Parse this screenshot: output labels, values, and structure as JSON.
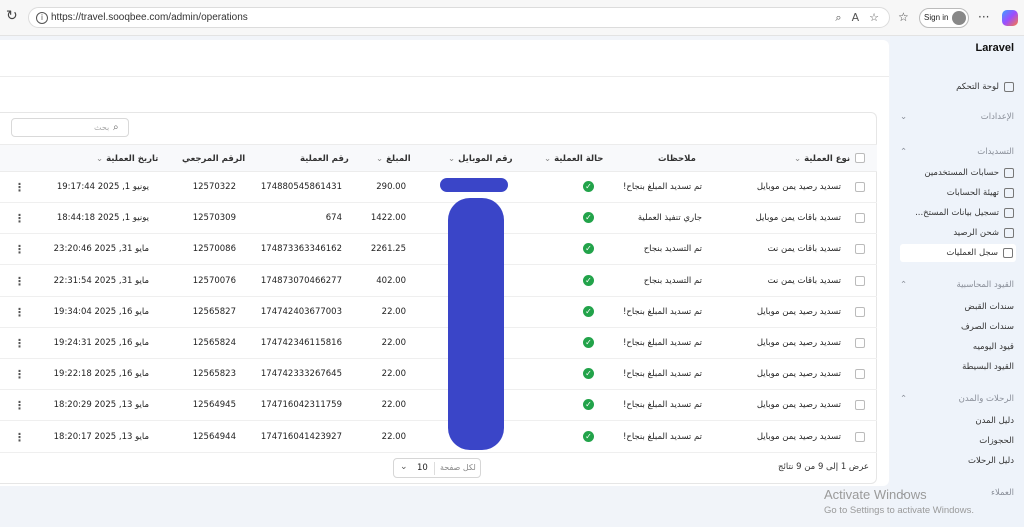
{
  "browser": {
    "url": "https://travel.sooqbee.com/admin/operations",
    "sign_in_label": "Sign in"
  },
  "sidebar": {
    "brand": "Laravel",
    "dashboard": "لوحة التحكم",
    "settings_section": "الإعدادات",
    "payments_section": "التسديدات",
    "payment_items": [
      "حسابات المستخدمين",
      "تهيئة الحسابات",
      "تسجيل بيانات المستخ...",
      "شحن الرصيد",
      "سجل العمليات"
    ],
    "active_item": "سجل العمليات",
    "accounting_section": "القيود المحاسبية",
    "accounting_items": [
      "سندات القبض",
      "سندات الصرف",
      "قيود اليوميه",
      "القيود البسيطة"
    ],
    "trips_section": "الرحلات والمدن",
    "trips_items": [
      "دليل المدن",
      "الحجوزات",
      "دليل الرحلات"
    ],
    "clients_section": "العملاء"
  },
  "table": {
    "search_placeholder": "بحث",
    "headers": {
      "operation_type": "نوع العملية",
      "notes": "ملاحظات",
      "status": "حالة العملية",
      "mobile": "رقم الموبايل",
      "amount": "المبلغ",
      "operation_number": "رقم العملية",
      "reference": "الرقم المرجعي",
      "date": "تاريخ العملية"
    },
    "rows": [
      {
        "type": "تسديد رصيد يمن موبايل",
        "notes": "تم تسديد المبلغ بنجاح!",
        "status": "success",
        "amount": "290.00",
        "op": "174880545861431",
        "ref": "12570322",
        "date": "يونيو 1, 2025 19:17:44"
      },
      {
        "type": "تسديد باقات يمن موبايل",
        "notes": "جاري تنفيذ العملية",
        "status": "success",
        "amount": "1422.00",
        "op": "674",
        "ref": "12570309",
        "date": "يونيو 1, 2025 18:44:18"
      },
      {
        "type": "تسديد باقات يمن نت",
        "notes": "تم التسديد بنجاح",
        "status": "success",
        "amount": "2261.25",
        "op": "174873363346162",
        "ref": "12570086",
        "date": "مايو 31, 2025 23:20:46"
      },
      {
        "type": "تسديد باقات يمن نت",
        "notes": "تم التسديد بنجاح",
        "status": "success",
        "amount": "402.00",
        "op": "174873070466277",
        "ref": "12570076",
        "date": "مايو 31, 2025 22:31:54"
      },
      {
        "type": "تسديد رصيد يمن موبايل",
        "notes": "تم تسديد المبلغ بنجاح!",
        "status": "success",
        "amount": "22.00",
        "op": "174742403677003",
        "ref": "12565827",
        "date": "مايو 16, 2025 19:34:04"
      },
      {
        "type": "تسديد رصيد يمن موبايل",
        "notes": "تم تسديد المبلغ بنجاح!",
        "status": "success",
        "amount": "22.00",
        "op": "174742346115816",
        "ref": "12565824",
        "date": "مايو 16, 2025 19:24:31"
      },
      {
        "type": "تسديد رصيد يمن موبايل",
        "notes": "تم تسديد المبلغ بنجاح!",
        "status": "success",
        "amount": "22.00",
        "op": "174742333267645",
        "ref": "12565823",
        "date": "مايو 16, 2025 19:22:18"
      },
      {
        "type": "تسديد رصيد يمن موبايل",
        "notes": "تم تسديد المبلغ بنجاح!",
        "status": "success",
        "amount": "22.00",
        "op": "174716042311759",
        "ref": "12564945",
        "date": "مايو 13, 2025 18:20:29"
      },
      {
        "type": "تسديد رصيد يمن موبايل",
        "notes": "تم تسديد المبلغ بنجاح!",
        "status": "success",
        "amount": "22.00",
        "op": "174716041423927",
        "ref": "12564944",
        "date": "مايو 13, 2025 18:20:17"
      }
    ],
    "footer_summary": "عرض 1 إلى 9 من 9 نتائج",
    "per_page_label": "لكل صفحة",
    "per_page_value": "10"
  },
  "watermark": {
    "line1": "Activate Windows",
    "line2": "Go to Settings to activate Windows."
  },
  "colors": {
    "success": "#22a34a",
    "redaction": "#3a45c8",
    "accent": "#eef3fa"
  }
}
